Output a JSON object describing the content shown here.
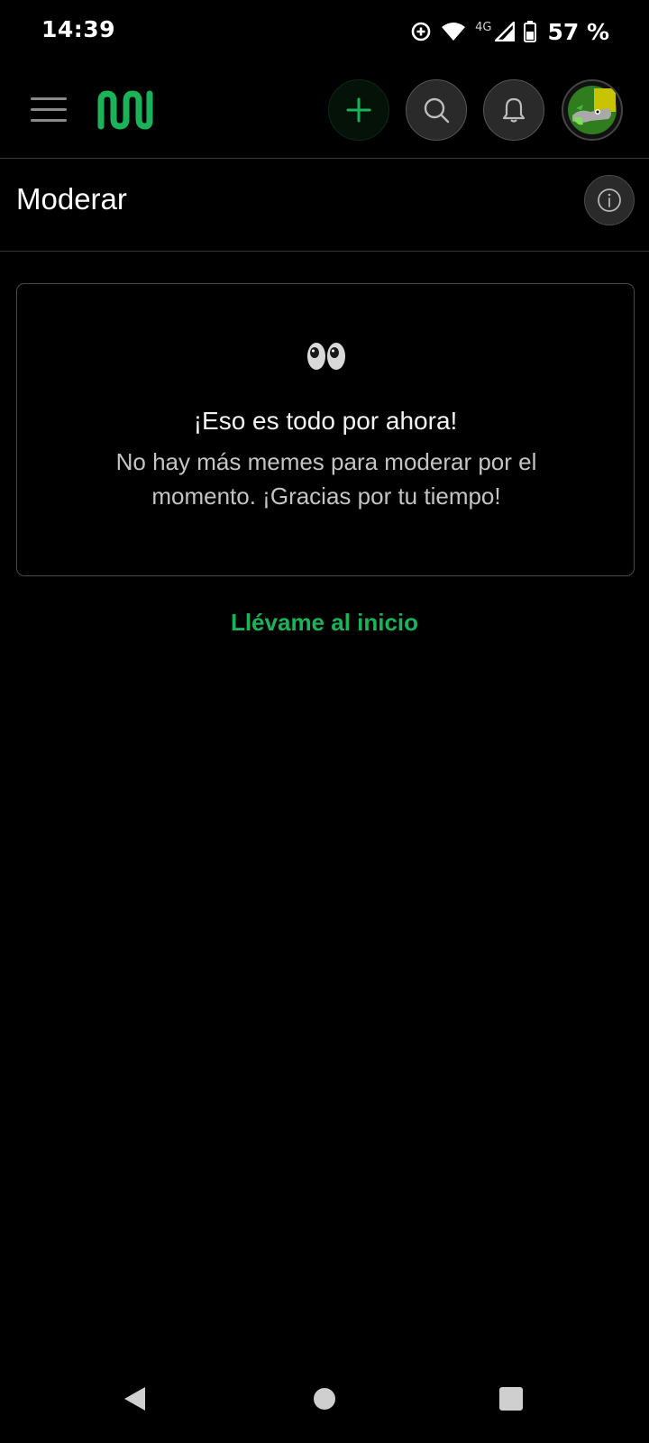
{
  "status_bar": {
    "time": "14:39",
    "network": "4G",
    "battery": "57 %"
  },
  "header": {
    "menu_icon": "hamburger-menu-icon",
    "logo_icon": "app-logo-icon",
    "add_icon": "plus-icon",
    "search_icon": "search-icon",
    "notifications_icon": "bell-icon",
    "avatar": "user-avatar"
  },
  "page": {
    "title": "Moderar",
    "info_icon": "info-icon"
  },
  "empty_state": {
    "emoji_icon": "eyes-icon",
    "title": "¡Eso es todo por ahora!",
    "message": "No hay más memes para moderar por el momento. ¡Gracias por tu tiempo!"
  },
  "home_link": "Llévame al inicio",
  "nav": {
    "back_icon": "back-triangle-icon",
    "home_icon": "home-circle-icon",
    "recents_icon": "recents-square-icon"
  },
  "colors": {
    "background": "#000000",
    "accent_green": "#1ab35a",
    "border": "#3a3a3a",
    "button_bg": "#2a2a2a"
  }
}
